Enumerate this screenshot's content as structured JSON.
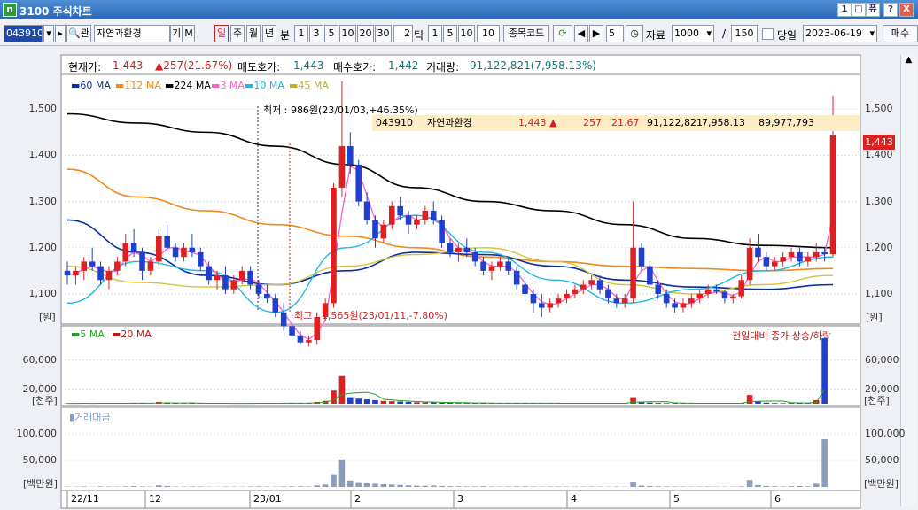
{
  "window": {
    "title": "3100 주식차트",
    "app_icon": "n",
    "buttons": [
      "1",
      "□",
      "퓨",
      "?",
      "X"
    ]
  },
  "toolbar": {
    "code": "043910",
    "name_search": "관",
    "stock_name": "자연과환경",
    "mode1": "기",
    "mode2": "M",
    "periods": [
      "일",
      "주",
      "월",
      "년"
    ],
    "min_label": "분",
    "minutes": [
      "1",
      "3",
      "5",
      "10",
      "20",
      "30"
    ],
    "tick_value": "2",
    "tick_label": "틱",
    "ticks": [
      "1",
      "5",
      "10"
    ],
    "tick_custom": "10",
    "code_label": "종목코드",
    "step": "5",
    "data_label": "자료",
    "data_count": "1000",
    "slash": "/",
    "view_count": "150",
    "today_label": "당일",
    "date": "2023-06-19",
    "right_btn": "매수"
  },
  "info": {
    "cur_label": "현재가:",
    "cur_value": "1,443",
    "change": "▲257(21.67%)",
    "ask_label": "매도호가:",
    "ask_value": "1,443",
    "bid_label": "매수호가:",
    "bid_value": "1,442",
    "vol_label": "거래량:",
    "vol_value": "91,122,821(7,958.13%)"
  },
  "legend_main": [
    {
      "name": "60 MA",
      "color": "#0a2f9e"
    },
    {
      "name": "112 MA",
      "color": "#f08a1c"
    },
    {
      "name": "224 MA",
      "color": "#000000"
    },
    {
      "name": "3 MA",
      "color": "#ff5fc8"
    },
    {
      "name": "10 MA",
      "color": "#1fb7e0"
    },
    {
      "name": "45 MA",
      "color": "#d6c23a"
    }
  ],
  "legend_vol": [
    {
      "name": "5 MA",
      "color": "#1fa31f"
    },
    {
      "name": "20 MA",
      "color": "#c41313"
    }
  ],
  "legend_amt": {
    "name": "거래대금",
    "color": "#8a9dc0"
  },
  "vol_right_label": "전일대비 종가 상승/하락",
  "annotations": {
    "high": "최저 : 986원(23/01/03,+46.35%)",
    "low": "최고 : 1,565원(23/01/11,-7.80%)"
  },
  "quote": {
    "code": "043910",
    "name": "자연과환경",
    "price": "1,443",
    "arrow": "▲",
    "diff": "257",
    "pct": "21.67",
    "volume": "91,122,821",
    "ratio": "7,958.13",
    "amount": "89,977,793"
  },
  "price_tag": "1,443",
  "units": {
    "price": "[원]",
    "vol": "[천주]",
    "amt": "[백만원]"
  },
  "chart_data": [
    {
      "type": "candlestick",
      "name": "price",
      "y_ticks": [
        1100,
        1200,
        1300,
        1400,
        1500
      ],
      "y_labels": [
        "1,100",
        "1,200",
        "1,300",
        "1,400",
        "1,500"
      ],
      "ylim": [
        1050,
        1560
      ],
      "x_labels": [
        "22/11",
        "12",
        "23/01",
        "2",
        "3",
        "4",
        "5",
        "6"
      ],
      "ohlc": [
        [
          1150,
          1170,
          1120,
          1140
        ],
        [
          1140,
          1160,
          1120,
          1150
        ],
        [
          1150,
          1180,
          1130,
          1170
        ],
        [
          1170,
          1200,
          1150,
          1160
        ],
        [
          1160,
          1170,
          1120,
          1130
        ],
        [
          1130,
          1160,
          1110,
          1150
        ],
        [
          1150,
          1180,
          1140,
          1170
        ],
        [
          1170,
          1230,
          1160,
          1210
        ],
        [
          1210,
          1240,
          1180,
          1190
        ],
        [
          1190,
          1200,
          1130,
          1150
        ],
        [
          1150,
          1180,
          1140,
          1170
        ],
        [
          1170,
          1240,
          1160,
          1225
        ],
        [
          1225,
          1250,
          1190,
          1200
        ],
        [
          1200,
          1210,
          1170,
          1180
        ],
        [
          1180,
          1210,
          1170,
          1200
        ],
        [
          1200,
          1230,
          1180,
          1190
        ],
        [
          1190,
          1200,
          1150,
          1160
        ],
        [
          1160,
          1170,
          1120,
          1130
        ],
        [
          1130,
          1150,
          1110,
          1140
        ],
        [
          1140,
          1160,
          1100,
          1110
        ],
        [
          1110,
          1140,
          1100,
          1130
        ],
        [
          1130,
          1160,
          1120,
          1150
        ],
        [
          1150,
          1160,
          1110,
          1120
        ],
        [
          1120,
          1130,
          1090,
          1100
        ],
        [
          1100,
          1120,
          1080,
          1090
        ],
        [
          1090,
          1100,
          1050,
          1060
        ],
        [
          1060,
          1080,
          1020,
          1030
        ],
        [
          1030,
          1050,
          1000,
          1010
        ],
        [
          1010,
          1020,
          990,
          995
        ],
        [
          995,
          1010,
          986,
          1000
        ],
        [
          1000,
          1060,
          990,
          1050
        ],
        [
          1050,
          1090,
          1040,
          1080
        ],
        [
          1080,
          1340,
          1070,
          1330
        ],
        [
          1330,
          1565,
          1310,
          1420
        ],
        [
          1420,
          1450,
          1360,
          1380
        ],
        [
          1380,
          1390,
          1290,
          1300
        ],
        [
          1300,
          1320,
          1250,
          1260
        ],
        [
          1260,
          1270,
          1200,
          1220
        ],
        [
          1220,
          1260,
          1210,
          1250
        ],
        [
          1250,
          1300,
          1240,
          1290
        ],
        [
          1290,
          1310,
          1260,
          1270
        ],
        [
          1270,
          1280,
          1230,
          1250
        ],
        [
          1250,
          1270,
          1240,
          1260
        ],
        [
          1260,
          1290,
          1250,
          1280
        ],
        [
          1280,
          1300,
          1250,
          1260
        ],
        [
          1260,
          1270,
          1200,
          1210
        ],
        [
          1210,
          1220,
          1180,
          1190
        ],
        [
          1190,
          1210,
          1170,
          1200
        ],
        [
          1200,
          1220,
          1180,
          1190
        ],
        [
          1190,
          1200,
          1160,
          1170
        ],
        [
          1170,
          1180,
          1140,
          1150
        ],
        [
          1150,
          1170,
          1130,
          1160
        ],
        [
          1160,
          1180,
          1150,
          1170
        ],
        [
          1170,
          1180,
          1140,
          1150
        ],
        [
          1150,
          1160,
          1110,
          1120
        ],
        [
          1120,
          1130,
          1090,
          1100
        ],
        [
          1100,
          1110,
          1060,
          1080
        ],
        [
          1080,
          1100,
          1050,
          1070
        ],
        [
          1070,
          1090,
          1060,
          1080
        ],
        [
          1080,
          1100,
          1070,
          1090
        ],
        [
          1090,
          1110,
          1080,
          1100
        ],
        [
          1100,
          1120,
          1090,
          1110
        ],
        [
          1110,
          1130,
          1100,
          1120
        ],
        [
          1120,
          1140,
          1110,
          1130
        ],
        [
          1130,
          1140,
          1100,
          1110
        ],
        [
          1110,
          1120,
          1080,
          1090
        ],
        [
          1090,
          1100,
          1070,
          1080
        ],
        [
          1080,
          1100,
          1070,
          1090
        ],
        [
          1090,
          1300,
          1080,
          1200
        ],
        [
          1200,
          1210,
          1150,
          1160
        ],
        [
          1160,
          1170,
          1110,
          1120
        ],
        [
          1120,
          1130,
          1090,
          1100
        ],
        [
          1100,
          1110,
          1070,
          1080
        ],
        [
          1080,
          1090,
          1060,
          1070
        ],
        [
          1070,
          1090,
          1060,
          1080
        ],
        [
          1080,
          1100,
          1070,
          1090
        ],
        [
          1090,
          1110,
          1080,
          1100
        ],
        [
          1100,
          1120,
          1090,
          1110
        ],
        [
          1110,
          1120,
          1100,
          1105
        ],
        [
          1105,
          1110,
          1080,
          1090
        ],
        [
          1090,
          1100,
          1080,
          1095
        ],
        [
          1095,
          1140,
          1090,
          1130
        ],
        [
          1130,
          1220,
          1120,
          1200
        ],
        [
          1200,
          1230,
          1170,
          1180
        ],
        [
          1180,
          1190,
          1150,
          1160
        ],
        [
          1160,
          1180,
          1150,
          1170
        ],
        [
          1170,
          1190,
          1160,
          1180
        ],
        [
          1180,
          1200,
          1170,
          1190
        ],
        [
          1190,
          1200,
          1160,
          1170
        ],
        [
          1170,
          1190,
          1160,
          1180
        ],
        [
          1180,
          1210,
          1170,
          1190
        ],
        [
          1190,
          1200,
          1170,
          1186
        ],
        [
          1186,
          1530,
          1180,
          1443
        ]
      ],
      "ma_224": [
        1490,
        1470,
        1450,
        1420,
        1380,
        1330,
        1300,
        1280,
        1250,
        1220,
        1205,
        1200
      ],
      "ma_112": [
        1370,
        1310,
        1280,
        1250,
        1225,
        1200,
        1180,
        1170,
        1160,
        1155,
        1150,
        1155
      ],
      "ma_60": [
        1260,
        1190,
        1140,
        1120,
        1150,
        1190,
        1185,
        1160,
        1130,
        1115,
        1110,
        1120
      ],
      "ma_45": [
        1160,
        1125,
        1115,
        1120,
        1160,
        1185,
        1200,
        1170,
        1120,
        1100,
        1120,
        1140
      ],
      "ma_10": [
        1080,
        1170,
        1150,
        1060,
        1200,
        1270,
        1190,
        1130,
        1080,
        1110,
        1150,
        1180
      ]
    },
    {
      "type": "bar",
      "name": "volume",
      "y_ticks": [
        20000,
        60000
      ],
      "y_labels": [
        "20,000",
        "60,000"
      ],
      "ylim": [
        0,
        90000
      ],
      "values": [
        500,
        400,
        700,
        300,
        800,
        600,
        500,
        900,
        1200,
        700,
        400,
        2500,
        1500,
        600,
        500,
        800,
        700,
        400,
        300,
        600,
        500,
        400,
        700,
        900,
        600,
        500,
        800,
        1000,
        1200,
        900,
        2500,
        4000,
        18000,
        38000,
        9000,
        7000,
        6000,
        5000,
        4000,
        3500,
        3000,
        2500,
        2000,
        1800,
        2200,
        1500,
        1200,
        1000,
        800,
        900,
        1100,
        700,
        600,
        800,
        900,
        1000,
        700,
        500,
        600,
        700,
        600,
        500,
        600,
        700,
        500,
        400,
        600,
        500,
        9000,
        2000,
        1500,
        1000,
        800,
        700,
        600,
        500,
        600,
        700,
        500,
        400,
        500,
        900,
        12000,
        3000,
        1500,
        1000,
        800,
        1200,
        1500,
        1000,
        5000,
        91122
      ]
    },
    {
      "type": "bar",
      "name": "amount",
      "y_ticks": [
        50000,
        100000
      ],
      "y_labels": [
        "50,000",
        "100,000"
      ],
      "ylim": [
        0,
        130000
      ],
      "values": [
        600,
        500,
        900,
        400,
        1000,
        700,
        600,
        1100,
        1500,
        900,
        500,
        3000,
        1800,
        700,
        600,
        900,
        800,
        500,
        400,
        700,
        600,
        500,
        800,
        1000,
        700,
        600,
        900,
        1100,
        1200,
        900,
        2800,
        4500,
        24000,
        52000,
        12000,
        9000,
        8000,
        6000,
        5000,
        4500,
        3800,
        3000,
        2400,
        2200,
        2700,
        1800,
        1400,
        1200,
        900,
        1000,
        1300,
        800,
        700,
        900,
        1000,
        1100,
        800,
        600,
        700,
        800,
        700,
        600,
        700,
        800,
        600,
        500,
        700,
        600,
        10000,
        2400,
        1700,
        1100,
        900,
        800,
        700,
        600,
        700,
        800,
        600,
        500,
        600,
        1000,
        13000,
        3500,
        1800,
        1200,
        900,
        1400,
        1700,
        1200,
        6000,
        89977
      ]
    }
  ]
}
